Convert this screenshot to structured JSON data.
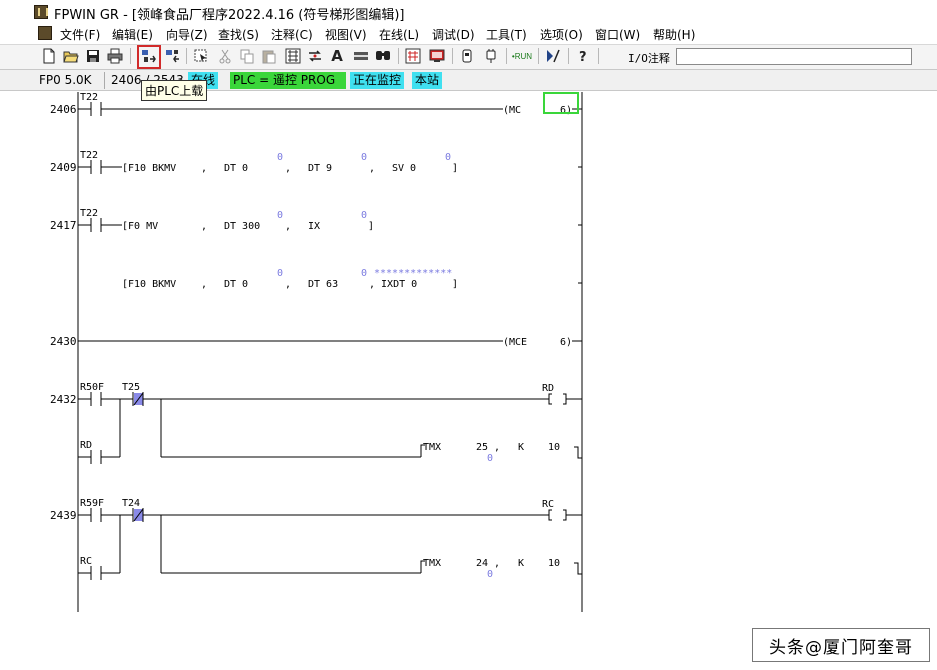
{
  "title": "FPWIN GR - [领峰食品厂程序2022.4.16 (符号梯形图编辑)]",
  "menu": [
    "文件(F)",
    "编辑(E)",
    "向导(Z)",
    "查找(S)",
    "注释(C)",
    "视图(V)",
    "在线(L)",
    "调试(D)",
    "工具(T)",
    "选项(O)",
    "窗口(W)",
    "帮助(H)"
  ],
  "toolbar": {
    "icons": [
      "new-file-icon",
      "open-folder-icon",
      "save-icon",
      "print-icon",
      "upload-from-plc-icon",
      "download-to-plc-icon",
      "select-icon",
      "cut-icon",
      "copy-icon",
      "paste-icon",
      "convert-icon",
      "replace-icon",
      "text-icon",
      "bar-icon",
      "find-icon",
      "io-map-icon",
      "monitor-icon",
      "plc-mode-icon",
      "plc-link-icon",
      "run-icon",
      "stop-icon",
      "help-icon"
    ],
    "text_glyph": "A",
    "run_label": "•RUN",
    "io_comment_label": "I/O注释",
    "io_comment_value": ""
  },
  "status": {
    "model": "FP0 5.0K",
    "address": "2406 / 2543",
    "online": "在线",
    "plc_mode": "PLC = 遥控 PROG",
    "monitoring": "正在监控",
    "station": "本站"
  },
  "tooltip": "由PLC上载",
  "ladder": {
    "rungs": [
      {
        "num": "2406",
        "contact": "T22",
        "coil": "(MC",
        "coil_param": "6)"
      },
      {
        "num": "2409",
        "contact": "T22",
        "inst": [
          "[F10 BKMV",
          ",",
          "DT 0",
          ",",
          "DT 9",
          ",",
          "SV 0",
          "]"
        ],
        "mon": [
          "0",
          "0",
          "0"
        ]
      },
      {
        "num": "2417",
        "contact": "T22",
        "inst": [
          "[F0 MV",
          ",",
          "DT 300",
          ",",
          "IX",
          "]"
        ],
        "mon": [
          "0",
          "0"
        ]
      },
      {
        "num": "",
        "inst": [
          "[F10 BKMV",
          ",",
          "DT 0",
          ",",
          "DT 63",
          ", IXDT 0",
          "]"
        ],
        "mon": [
          "0",
          "0",
          "*************"
        ]
      },
      {
        "num": "2430",
        "coil": "(MCE",
        "coil_param": "6)"
      },
      {
        "num": "2432",
        "contacts": [
          "R50F",
          "T25",
          "RD"
        ],
        "coil": "RD",
        "timer": [
          "TMX",
          "25",
          ",",
          "K",
          "10"
        ],
        "timer_mon": "0"
      },
      {
        "num": "2439",
        "contacts": [
          "R59F",
          "T24",
          "RC"
        ],
        "coil": "RC",
        "timer": [
          "TMX",
          "24",
          ",",
          "K",
          "10"
        ],
        "timer_mon": "0"
      }
    ]
  },
  "watermark": "头条@厦门阿奎哥",
  "colors": {
    "online": "#40e0f0",
    "plc": "#3ad63a",
    "monitor_value": "#7a7ae0",
    "cursor": "#3ad63a",
    "highlight": "#d12a2a"
  }
}
